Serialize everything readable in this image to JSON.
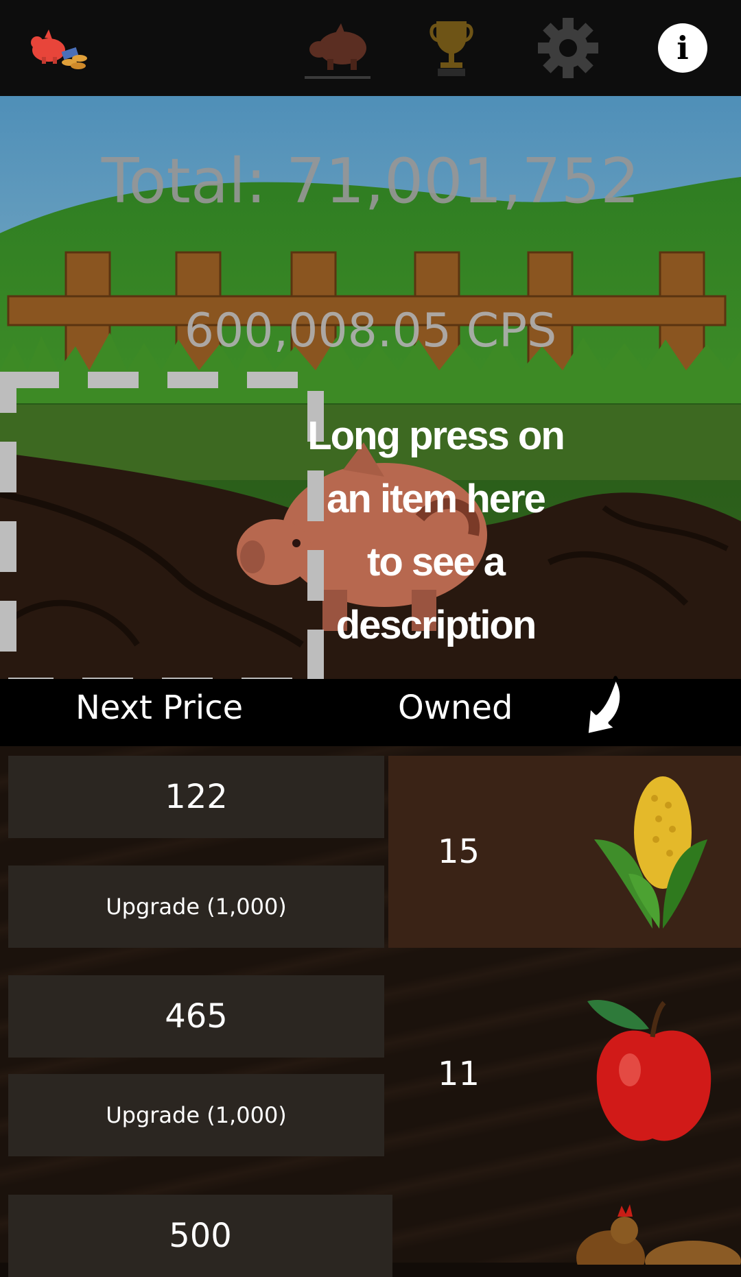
{
  "nav": {
    "logo_icon": "piggy-bank-coins-icon",
    "tabs": [
      {
        "icon": "pig-icon",
        "selected": true
      },
      {
        "icon": "trophy-icon",
        "selected": false
      },
      {
        "icon": "gear-icon",
        "selected": false
      }
    ],
    "info_glyph": "i"
  },
  "stats": {
    "total": "Total: 71,001,752",
    "cps": "600,008.05 CPS"
  },
  "tutorial": {
    "lines": [
      "Long press on",
      "an item here",
      "to see a",
      "description"
    ]
  },
  "columns": {
    "next_price": "Next Price",
    "owned": "Owned"
  },
  "items": [
    {
      "icon": "corn-icon",
      "next_price": "122",
      "upgrade": "Upgrade (1,000)",
      "owned": "15"
    },
    {
      "icon": "apple-icon",
      "next_price": "465",
      "upgrade": "Upgrade (1,000)",
      "owned": "11"
    },
    {
      "icon": "chicken-icon",
      "next_price": "500"
    }
  ],
  "colors": {
    "top_bar": "#0d0d0d",
    "button": "#2b2621",
    "header_bar": "#000000",
    "stat_text": "#969696"
  }
}
